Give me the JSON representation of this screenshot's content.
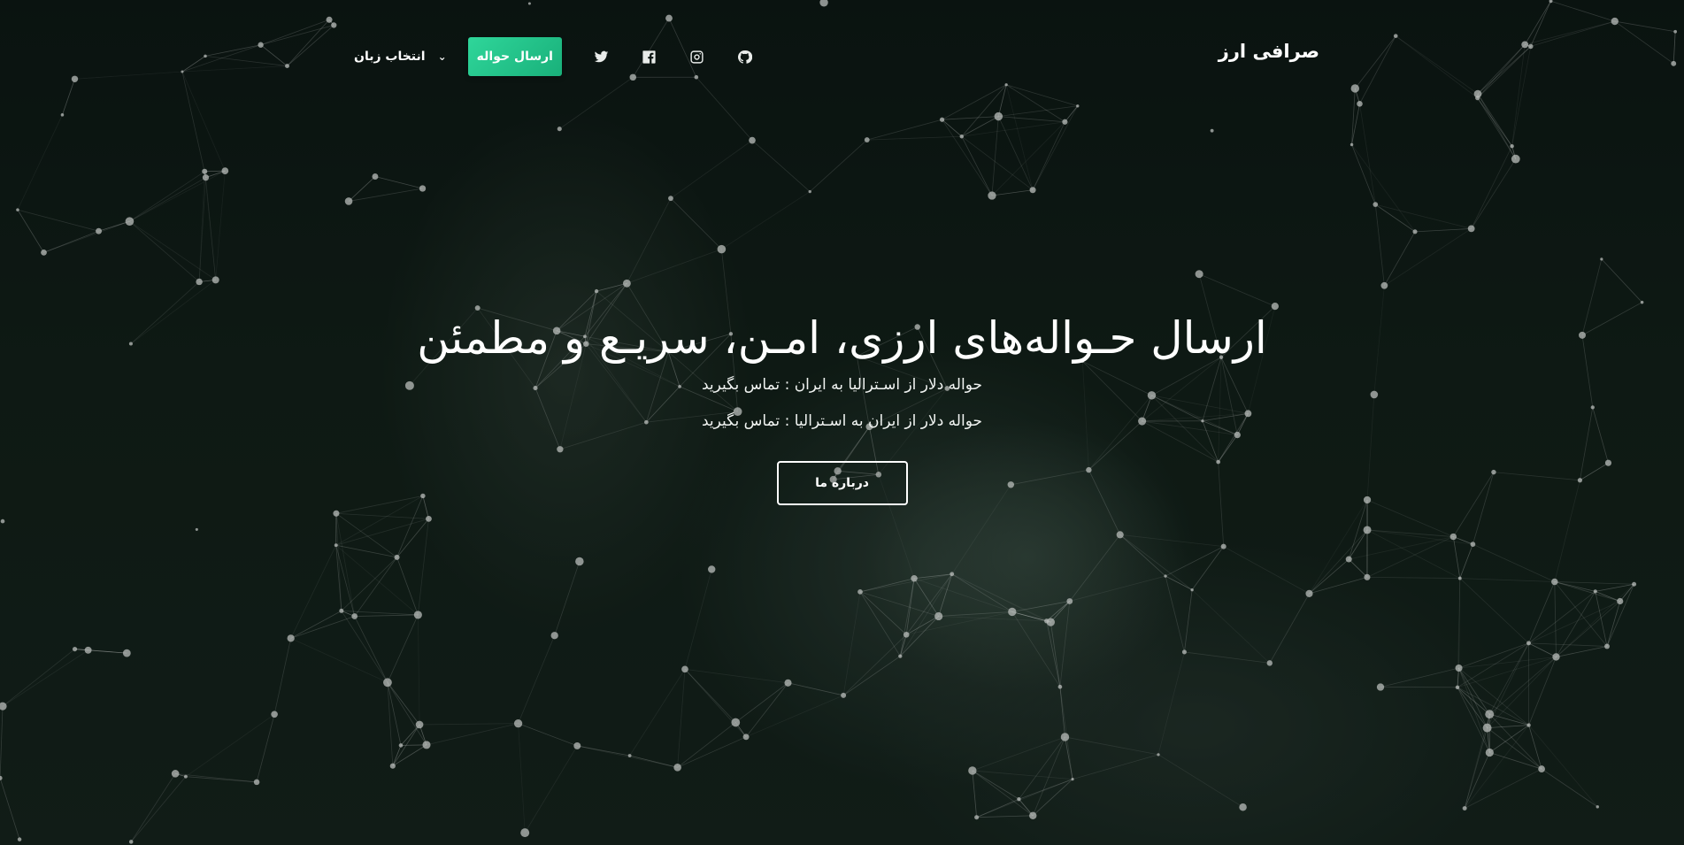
{
  "brand": {
    "name": "صرافی ارز"
  },
  "nav": {
    "language_label": "انتخاب زبان",
    "language_chevron": "⌄",
    "send_button": "ارسال حواله",
    "social_icons": [
      "twitter-icon",
      "facebook-icon",
      "instagram-icon",
      "github-icon"
    ]
  },
  "hero": {
    "title": "ارسال حـواله‌های ارزی، امـن، سریـع و مطمئن",
    "line_1": "حواله دلار از اسـترالیا به ایران : تماس بگیرید",
    "line_2": "حواله دلار از ایران به اسـترالیا : تماس بگیرید",
    "about_button": "درباره ما"
  },
  "colors": {
    "accent": "#1fbf86",
    "background": "#0c1512",
    "network_lines": "#ffffff"
  }
}
